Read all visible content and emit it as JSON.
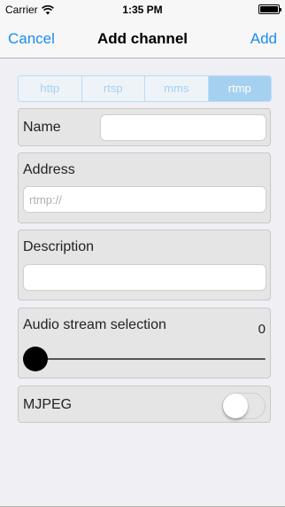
{
  "status_bar": {
    "carrier": "Carrier",
    "time": "1:35 PM"
  },
  "nav": {
    "cancel_label": "Cancel",
    "title": "Add channel",
    "add_label": "Add",
    "accent_color": "#1a8cf0"
  },
  "protocol": {
    "options": [
      "http",
      "rtsp",
      "mms",
      "rtmp"
    ],
    "selected": "rtmp"
  },
  "form": {
    "name": {
      "label": "Name",
      "value": "",
      "placeholder": ""
    },
    "address": {
      "label": "Address",
      "value": "",
      "placeholder": "rtmp://"
    },
    "description": {
      "label": "Description",
      "value": "",
      "placeholder": ""
    },
    "audio": {
      "label": "Audio stream selection",
      "value": "0",
      "slider_fraction": 0.0
    },
    "mjpeg": {
      "label": "MJPEG",
      "enabled": false
    }
  }
}
